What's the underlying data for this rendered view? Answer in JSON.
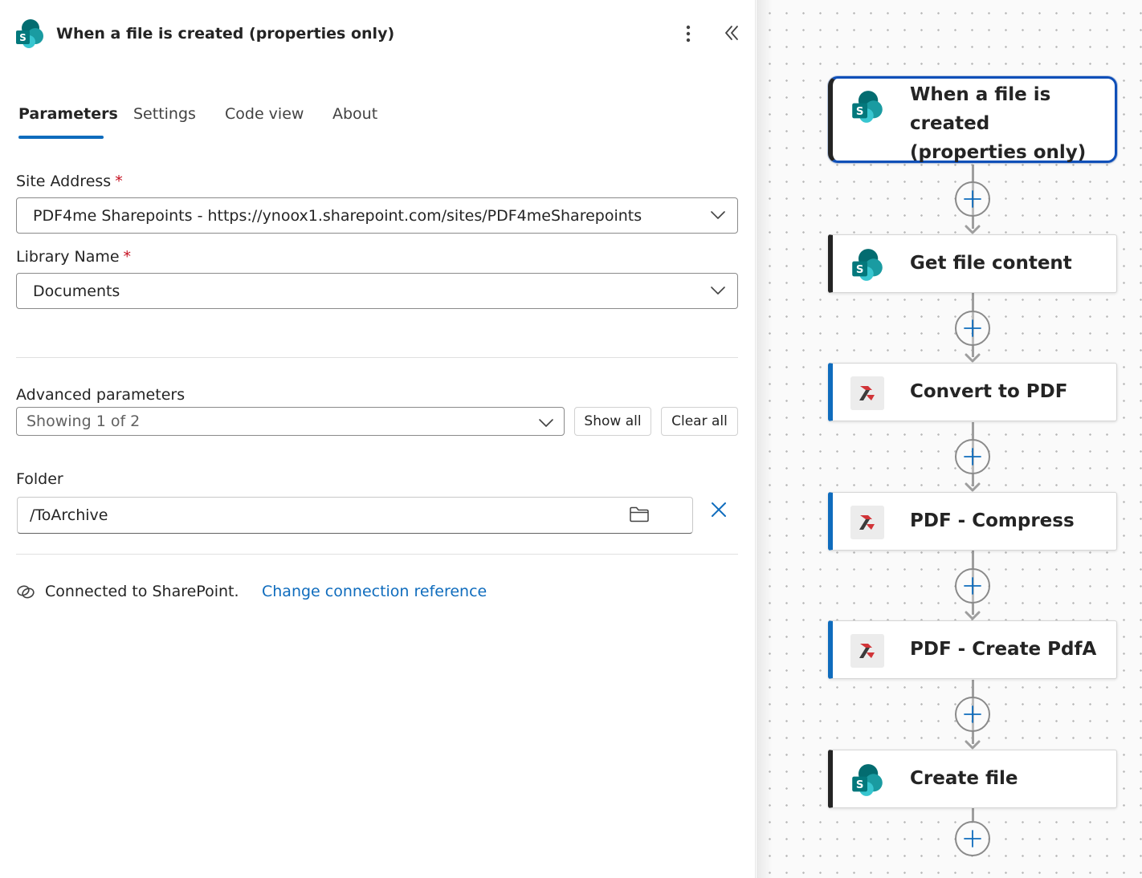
{
  "panel": {
    "title": "When a file is created (properties only)",
    "tabs": [
      {
        "label": "Parameters",
        "active": true
      },
      {
        "label": "Settings"
      },
      {
        "label": "Code view"
      },
      {
        "label": "About"
      }
    ],
    "site_address": {
      "label": "Site Address",
      "required": "*",
      "value": "PDF4me Sharepoints - https://ynoox1.sharepoint.com/sites/PDF4meSharepoints"
    },
    "library_name": {
      "label": "Library Name",
      "required": "*",
      "value": "Documents"
    },
    "advanced": {
      "label": "Advanced parameters",
      "value": "Showing 1 of 2",
      "show_all": "Show all",
      "clear_all": "Clear all"
    },
    "folder": {
      "label": "Folder",
      "value": "/ToArchive"
    },
    "connection": {
      "text": "Connected to SharePoint.",
      "link": "Change connection reference"
    }
  },
  "flow": {
    "steps": [
      {
        "title": "When a file is created (properties only)",
        "icon": "sharepoint-icon",
        "selected": true
      },
      {
        "title": "Get file content",
        "icon": "sharepoint-icon"
      },
      {
        "title": "Convert to PDF",
        "icon": "pdf4me-icon"
      },
      {
        "title": "PDF - Compress",
        "icon": "pdf4me-icon"
      },
      {
        "title": "PDF - Create PdfA",
        "icon": "pdf4me-icon"
      },
      {
        "title": "Create file",
        "icon": "sharepoint-icon"
      }
    ]
  },
  "colors": {
    "accent": "#0f6cbd",
    "required": "#c50f1f",
    "selected_border": "#0f4fb8",
    "sharepoint_teal": "#038387",
    "pdf4me_red": "#d13438"
  }
}
